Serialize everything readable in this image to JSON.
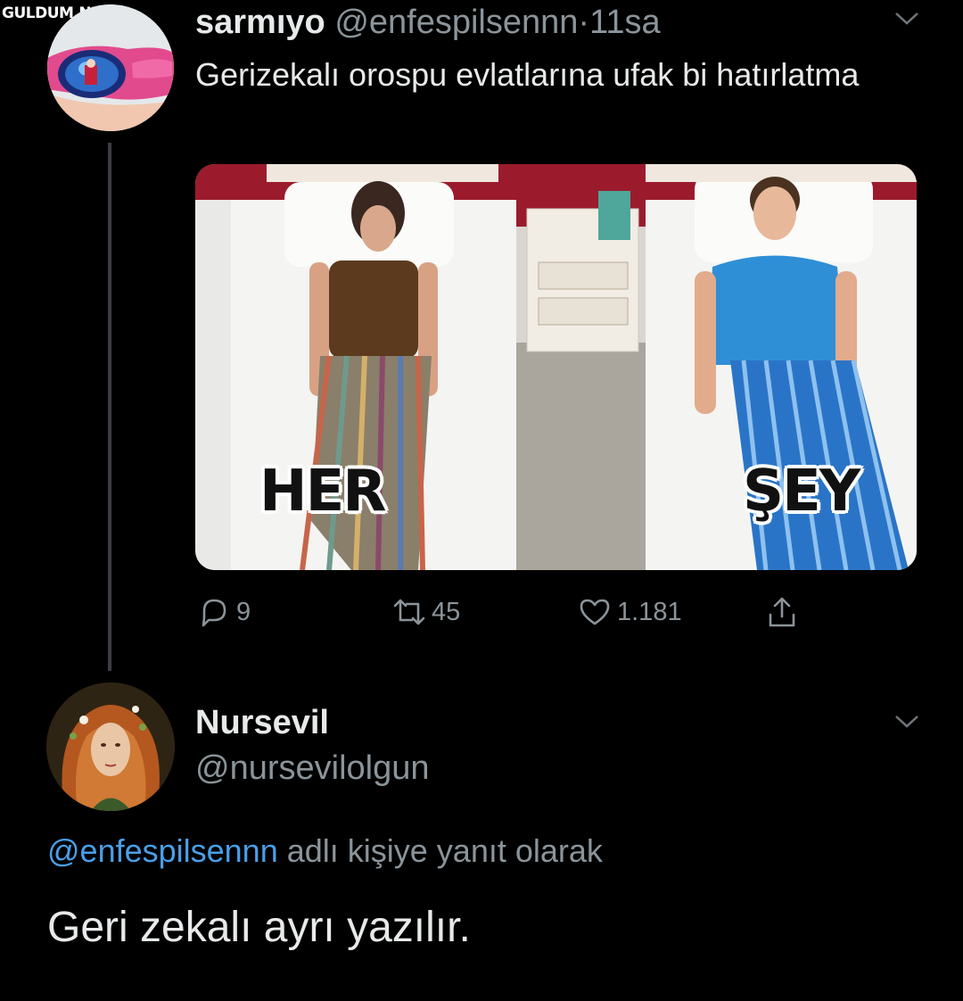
{
  "watermark": "GULDUM.NET",
  "tweet1": {
    "name": "sarmıyo",
    "handle": "@enfespilsennn",
    "separator": "·",
    "time": "11sa",
    "text": "Gerizekalı orospu evlatlarına ufak bi hatırlatma",
    "media": {
      "left_caption": "HER",
      "right_caption": "ŞEY"
    },
    "actions": {
      "replies": "9",
      "retweets": "45",
      "likes": "1.181"
    }
  },
  "tweet2": {
    "name": "Nursevil",
    "handle": "@nursevilolgun",
    "reply_to_handle": "@enfespilsennn",
    "reply_to_suffix": "adlı kişiye yanıt olarak",
    "text": "Geri zekalı ayrı yazılır."
  },
  "colors": {
    "background": "#000000",
    "primary_text": "#e7e9ea",
    "secondary_text": "#8b949a",
    "link": "#4a9fe8"
  },
  "icons": [
    "reply-icon",
    "retweet-icon",
    "like-icon",
    "share-icon",
    "chevron-down-icon"
  ]
}
